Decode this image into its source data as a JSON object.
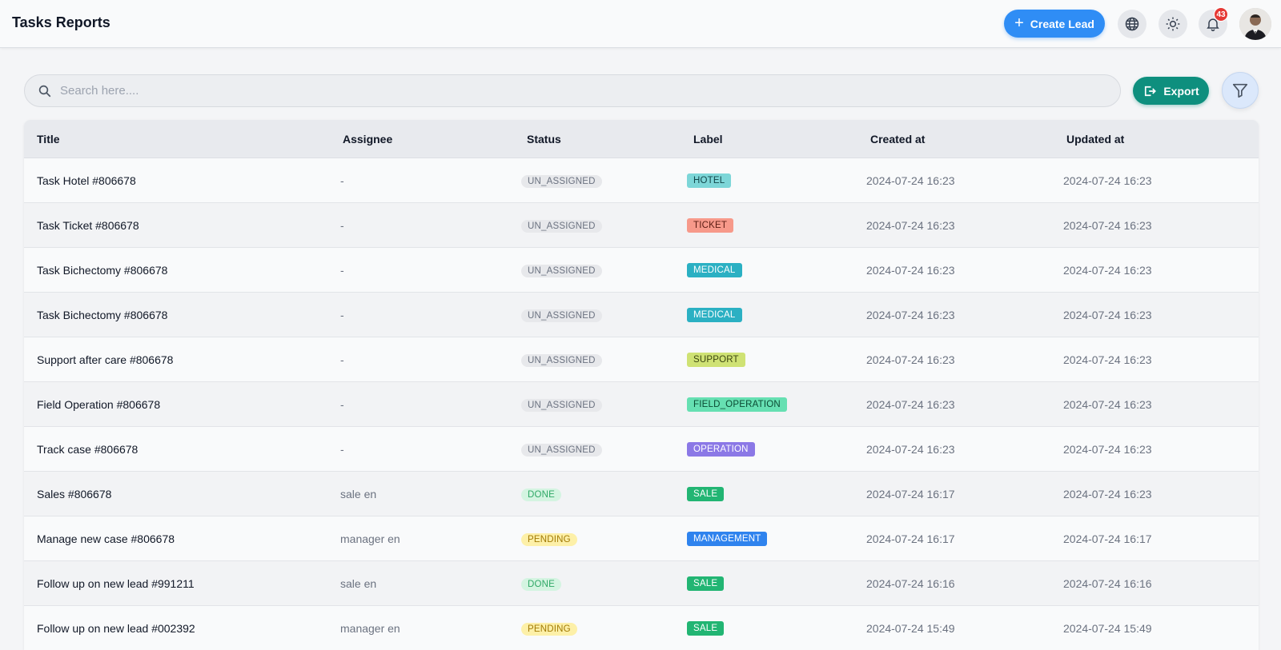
{
  "header": {
    "title": "Tasks Reports",
    "create_lead_label": "Create Lead",
    "notification_count": "43"
  },
  "toolbar": {
    "search_placeholder": "Search here....",
    "search_value": "",
    "export_label": "Export"
  },
  "table": {
    "columns": [
      "Title",
      "Assignee",
      "Status",
      "Label",
      "Created at",
      "Updated at"
    ],
    "rows": [
      {
        "title": "Task Hotel #806678",
        "assignee": "-",
        "status": "UN_ASSIGNED",
        "label": "HOTEL",
        "created": "2024-07-24 16:23",
        "updated": "2024-07-24 16:23"
      },
      {
        "title": "Task Ticket #806678",
        "assignee": "-",
        "status": "UN_ASSIGNED",
        "label": "TICKET",
        "created": "2024-07-24 16:23",
        "updated": "2024-07-24 16:23"
      },
      {
        "title": "Task Bichectomy #806678",
        "assignee": "-",
        "status": "UN_ASSIGNED",
        "label": "MEDICAL",
        "created": "2024-07-24 16:23",
        "updated": "2024-07-24 16:23"
      },
      {
        "title": "Task Bichectomy #806678",
        "assignee": "-",
        "status": "UN_ASSIGNED",
        "label": "MEDICAL",
        "created": "2024-07-24 16:23",
        "updated": "2024-07-24 16:23"
      },
      {
        "title": "Support after care #806678",
        "assignee": "-",
        "status": "UN_ASSIGNED",
        "label": "SUPPORT",
        "created": "2024-07-24 16:23",
        "updated": "2024-07-24 16:23"
      },
      {
        "title": "Field Operation #806678",
        "assignee": "-",
        "status": "UN_ASSIGNED",
        "label": "FIELD_OPERATION",
        "created": "2024-07-24 16:23",
        "updated": "2024-07-24 16:23"
      },
      {
        "title": "Track case #806678",
        "assignee": "-",
        "status": "UN_ASSIGNED",
        "label": "OPERATION",
        "created": "2024-07-24 16:23",
        "updated": "2024-07-24 16:23"
      },
      {
        "title": "Sales #806678",
        "assignee": "sale en",
        "status": "DONE",
        "label": "SALE",
        "created": "2024-07-24 16:17",
        "updated": "2024-07-24 16:23"
      },
      {
        "title": "Manage new case #806678",
        "assignee": "manager en",
        "status": "PENDING",
        "label": "MANAGEMENT",
        "created": "2024-07-24 16:17",
        "updated": "2024-07-24 16:17"
      },
      {
        "title": "Follow up on new lead #991211",
        "assignee": "sale en",
        "status": "DONE",
        "label": "SALE",
        "created": "2024-07-24 16:16",
        "updated": "2024-07-24 16:16"
      },
      {
        "title": "Follow up on new lead #002392",
        "assignee": "manager en",
        "status": "PENDING",
        "label": "SALE",
        "created": "2024-07-24 15:49",
        "updated": "2024-07-24 15:49"
      }
    ]
  },
  "colors": {
    "primary": "#2f8df5",
    "export": "#0e8f7e",
    "badge": "#e53935"
  },
  "icons": {
    "globe": "globe-icon",
    "theme": "sun-icon",
    "bell": "bell-icon",
    "search": "search-icon",
    "export": "export-icon",
    "filter": "filter-icon"
  }
}
